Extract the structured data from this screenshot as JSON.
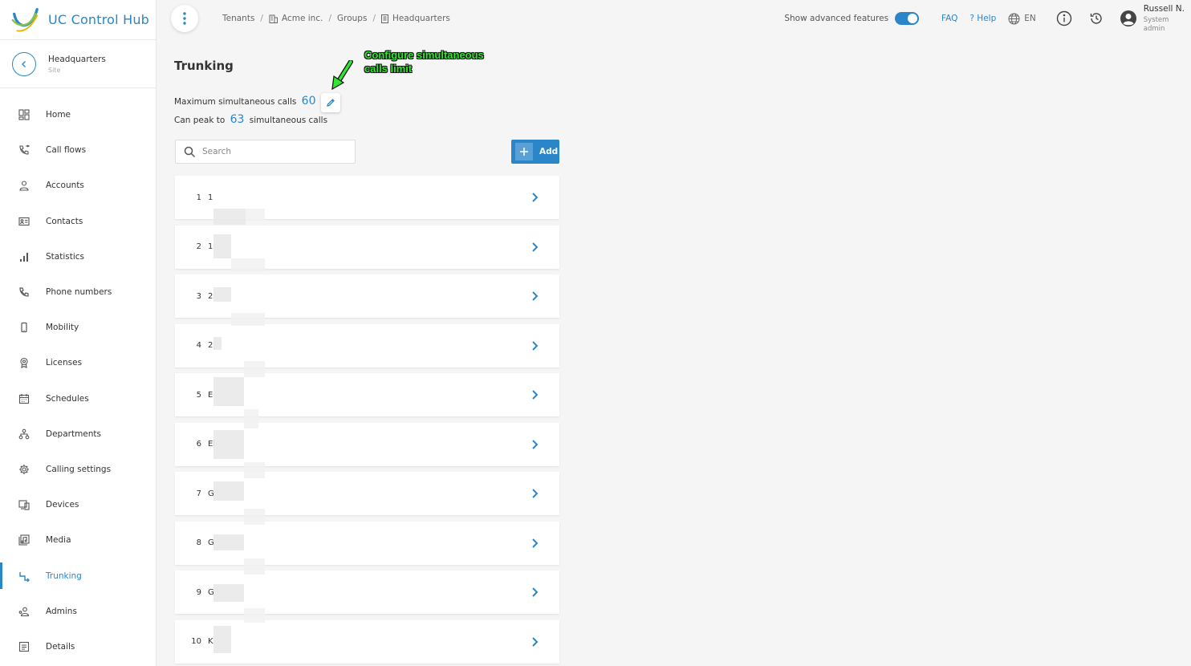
{
  "brand": {
    "name": "UC Control Hub"
  },
  "site": {
    "name": "Headquarters",
    "type": "Site"
  },
  "sidebar": {
    "items": [
      {
        "label": "Home",
        "icon": "home-grid-icon"
      },
      {
        "label": "Call flows",
        "icon": "call-flow-icon"
      },
      {
        "label": "Accounts",
        "icon": "person-icon"
      },
      {
        "label": "Contacts",
        "icon": "contact-card-icon"
      },
      {
        "label": "Statistics",
        "icon": "bar-chart-icon"
      },
      {
        "label": "Phone numbers",
        "icon": "phone-icon"
      },
      {
        "label": "Mobility",
        "icon": "mobile-icon"
      },
      {
        "label": "Licenses",
        "icon": "license-badge-icon"
      },
      {
        "label": "Schedules",
        "icon": "calendar-icon"
      },
      {
        "label": "Departments",
        "icon": "org-tree-icon"
      },
      {
        "label": "Calling settings",
        "icon": "gear-icon"
      },
      {
        "label": "Devices",
        "icon": "devices-icon"
      },
      {
        "label": "Media",
        "icon": "media-icon"
      },
      {
        "label": "Trunking",
        "icon": "trunk-icon",
        "active": true
      },
      {
        "label": "Admins",
        "icon": "admins-icon"
      },
      {
        "label": "Details",
        "icon": "details-icon"
      }
    ]
  },
  "breadcrumb": {
    "tenants": "Tenants",
    "tenant": "Acme inc.",
    "groups": "Groups",
    "site": "Headquarters"
  },
  "topbar": {
    "advanced_label": "Show advanced features",
    "faq": "FAQ",
    "help": "? Help",
    "lang": "EN",
    "user_name": "Russell N.",
    "user_role_1": "System",
    "user_role_2": "admin"
  },
  "main": {
    "title": "Trunking",
    "max_calls_label": "Maximum simultaneous calls",
    "max_calls_value": "60",
    "peak_prefix": "Can peak to",
    "peak_value": "63",
    "peak_suffix": "simultaneous calls",
    "search_placeholder": "Search",
    "add_label": "Add",
    "annotation": "Configure simultaneous\ncalls limit"
  },
  "trunks": [
    {
      "index": "1",
      "name": "1"
    },
    {
      "index": "2",
      "name": "1:"
    },
    {
      "index": "3",
      "name": "2:"
    },
    {
      "index": "4",
      "name": "2:"
    },
    {
      "index": "5",
      "name": "E"
    },
    {
      "index": "6",
      "name": "El"
    },
    {
      "index": "7",
      "name": "G"
    },
    {
      "index": "8",
      "name": "G"
    },
    {
      "index": "9",
      "name": "G"
    },
    {
      "index": "10",
      "name": "K"
    }
  ],
  "colors": {
    "accent": "#2a86c9",
    "annotation": "#2ee82e"
  }
}
